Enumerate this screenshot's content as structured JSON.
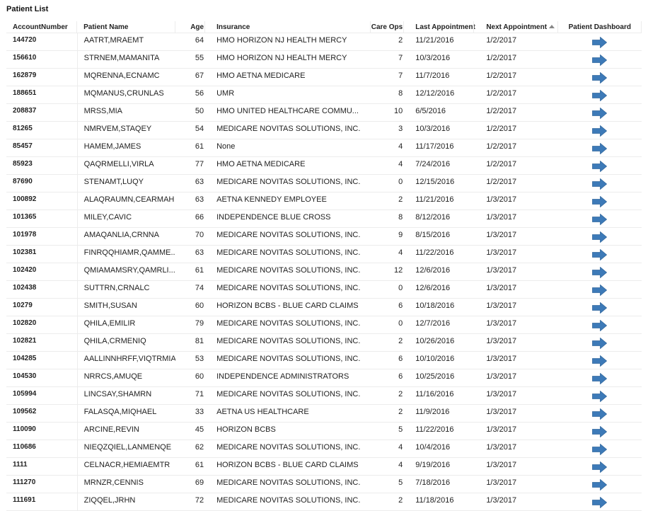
{
  "page": {
    "title": "Patient List"
  },
  "table": {
    "columns": {
      "account": "AccountNumber",
      "name": "Patient Name",
      "age": "Age",
      "insurance": "Insurance",
      "care_ops": "Care Ops",
      "last_appt": "Last Appointment",
      "next_appt": "Next Appointment",
      "dashboard": "Patient Dashboard"
    },
    "sort": {
      "column": "next_appt",
      "direction": "ascending",
      "icon": "sort-ascending-icon"
    },
    "row_action_icon": "arrow-right-icon",
    "accent_color": "#3d7ab8",
    "rows": [
      {
        "account": "144720",
        "name": "AATRT,MRAEMT",
        "age": "64",
        "insurance": "HMO HORIZON NJ HEALTH MERCY",
        "care_ops": "2",
        "last_appt": "11/21/2016",
        "next_appt": "1/2/2017"
      },
      {
        "account": "156610",
        "name": "STRNEM,MAMANITA",
        "age": "55",
        "insurance": "HMO HORIZON NJ HEALTH MERCY",
        "care_ops": "7",
        "last_appt": "10/3/2016",
        "next_appt": "1/2/2017"
      },
      {
        "account": "162879",
        "name": "MQRENNA,ECNAMC",
        "age": "67",
        "insurance": "HMO AETNA MEDICARE",
        "care_ops": "7",
        "last_appt": "11/7/2016",
        "next_appt": "1/2/2017"
      },
      {
        "account": "188651",
        "name": "MQMANUS,CRUNLAS",
        "age": "56",
        "insurance": "UMR",
        "care_ops": "8",
        "last_appt": "12/12/2016",
        "next_appt": "1/2/2017"
      },
      {
        "account": "208837",
        "name": "MRSS,MIA",
        "age": "50",
        "insurance": "HMO UNITED HEALTHCARE COMMU...",
        "care_ops": "10",
        "last_appt": "6/5/2016",
        "next_appt": "1/2/2017"
      },
      {
        "account": "81265",
        "name": "NMRVEM,STAQEY",
        "age": "54",
        "insurance": "MEDICARE NOVITAS SOLUTIONS, INC.",
        "care_ops": "3",
        "last_appt": "10/3/2016",
        "next_appt": "1/2/2017"
      },
      {
        "account": "85457",
        "name": "HAMEM,JAMES",
        "age": "61",
        "insurance": "None",
        "care_ops": "4",
        "last_appt": "11/17/2016",
        "next_appt": "1/2/2017"
      },
      {
        "account": "85923",
        "name": "QAQRMELLI,VIRLA",
        "age": "77",
        "insurance": "HMO AETNA MEDICARE",
        "care_ops": "4",
        "last_appt": "7/24/2016",
        "next_appt": "1/2/2017"
      },
      {
        "account": "87690",
        "name": "STENAMT,LUQY",
        "age": "63",
        "insurance": "MEDICARE NOVITAS SOLUTIONS, INC.",
        "care_ops": "0",
        "last_appt": "12/15/2016",
        "next_appt": "1/2/2017"
      },
      {
        "account": "100892",
        "name": "ALAQRAUMN,CEARMAH",
        "age": "63",
        "insurance": "AETNA KENNEDY EMPLOYEE",
        "care_ops": "2",
        "last_appt": "11/21/2016",
        "next_appt": "1/3/2017"
      },
      {
        "account": "101365",
        "name": "MILEY,CAVIC",
        "age": "66",
        "insurance": "INDEPENDENCE BLUE CROSS",
        "care_ops": "8",
        "last_appt": "8/12/2016",
        "next_appt": "1/3/2017"
      },
      {
        "account": "101978",
        "name": "AMAQANLIA,CRNNA",
        "age": "70",
        "insurance": "MEDICARE NOVITAS SOLUTIONS, INC.",
        "care_ops": "9",
        "last_appt": "8/15/2016",
        "next_appt": "1/3/2017"
      },
      {
        "account": "102381",
        "name": "FINRQQHIAMR,QAMME...",
        "age": "63",
        "insurance": "MEDICARE NOVITAS SOLUTIONS, INC.",
        "care_ops": "4",
        "last_appt": "11/22/2016",
        "next_appt": "1/3/2017"
      },
      {
        "account": "102420",
        "name": "QMIAMAMSRY,QAMRLI...",
        "age": "61",
        "insurance": "MEDICARE NOVITAS SOLUTIONS, INC.",
        "care_ops": "12",
        "last_appt": "12/6/2016",
        "next_appt": "1/3/2017"
      },
      {
        "account": "102438",
        "name": "SUTTRN,CRNALC",
        "age": "74",
        "insurance": "MEDICARE NOVITAS SOLUTIONS, INC.",
        "care_ops": "0",
        "last_appt": "12/6/2016",
        "next_appt": "1/3/2017"
      },
      {
        "account": "10279",
        "name": "SMITH,SUSAN",
        "age": "60",
        "insurance": "HORIZON BCBS - BLUE CARD CLAIMS",
        "care_ops": "6",
        "last_appt": "10/18/2016",
        "next_appt": "1/3/2017"
      },
      {
        "account": "102820",
        "name": "QHILA,EMILIR",
        "age": "79",
        "insurance": "MEDICARE NOVITAS SOLUTIONS, INC.",
        "care_ops": "0",
        "last_appt": "12/7/2016",
        "next_appt": "1/3/2017"
      },
      {
        "account": "102821",
        "name": "QHILA,CRMENIQ",
        "age": "81",
        "insurance": "MEDICARE NOVITAS SOLUTIONS, INC.",
        "care_ops": "2",
        "last_appt": "10/26/2016",
        "next_appt": "1/3/2017"
      },
      {
        "account": "104285",
        "name": "AALLINNHRFF,VIQTRMIA",
        "age": "53",
        "insurance": "MEDICARE NOVITAS SOLUTIONS, INC.",
        "care_ops": "6",
        "last_appt": "10/10/2016",
        "next_appt": "1/3/2017"
      },
      {
        "account": "104530",
        "name": "NRRCS,AMUQE",
        "age": "60",
        "insurance": "INDEPENDENCE ADMINISTRATORS",
        "care_ops": "6",
        "last_appt": "10/25/2016",
        "next_appt": "1/3/2017"
      },
      {
        "account": "105994",
        "name": "LINCSAY,SHAMRN",
        "age": "71",
        "insurance": "MEDICARE NOVITAS SOLUTIONS, INC.",
        "care_ops": "2",
        "last_appt": "11/16/2016",
        "next_appt": "1/3/2017"
      },
      {
        "account": "109562",
        "name": "FALASQA,MIQHAEL",
        "age": "33",
        "insurance": "AETNA US HEALTHCARE",
        "care_ops": "2",
        "last_appt": "11/9/2016",
        "next_appt": "1/3/2017"
      },
      {
        "account": "110090",
        "name": "ARCINE,REVIN",
        "age": "45",
        "insurance": "HORIZON BCBS",
        "care_ops": "5",
        "last_appt": "11/22/2016",
        "next_appt": "1/3/2017"
      },
      {
        "account": "110686",
        "name": "NIEQZQIEL,LANMENQE",
        "age": "62",
        "insurance": "MEDICARE NOVITAS SOLUTIONS, INC.",
        "care_ops": "4",
        "last_appt": "10/4/2016",
        "next_appt": "1/3/2017"
      },
      {
        "account": "1111",
        "name": "CELNACR,HEMIAEMTR",
        "age": "61",
        "insurance": "HORIZON BCBS - BLUE CARD CLAIMS",
        "care_ops": "4",
        "last_appt": "9/19/2016",
        "next_appt": "1/3/2017"
      },
      {
        "account": "111270",
        "name": "MRNZR,CENNIS",
        "age": "69",
        "insurance": "MEDICARE NOVITAS SOLUTIONS, INC.",
        "care_ops": "5",
        "last_appt": "7/18/2016",
        "next_appt": "1/3/2017"
      },
      {
        "account": "111691",
        "name": "ZIQQEL,JRHN",
        "age": "72",
        "insurance": "MEDICARE NOVITAS SOLUTIONS, INC.",
        "care_ops": "2",
        "last_appt": "11/18/2016",
        "next_appt": "1/3/2017"
      }
    ]
  }
}
